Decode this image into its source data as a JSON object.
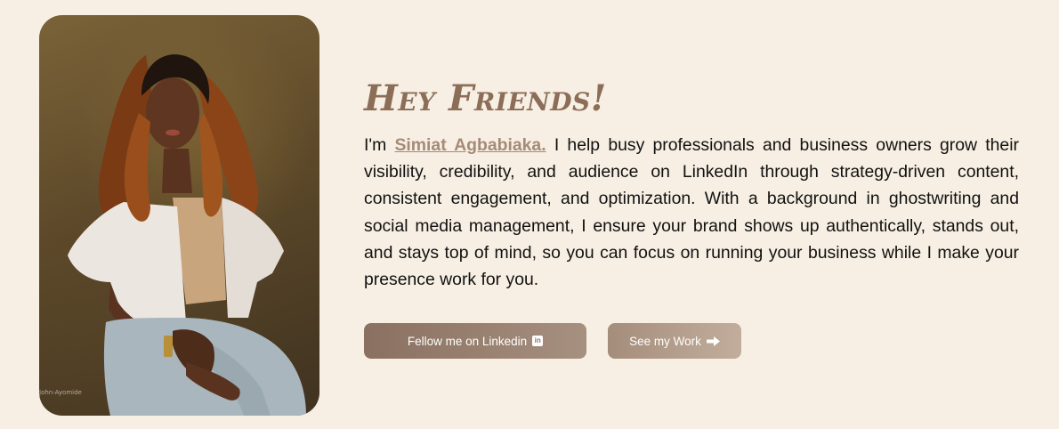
{
  "about": {
    "heading": "Hey Friends!",
    "intro_prefix": "I'm ",
    "name": "Simiat Agbabiaka.",
    "intro_body": " I help busy professionals and business owners grow their visibility, credibility, and audience on LinkedIn through strategy-driven content, consistent engagement, and optimization. With a background in ghostwriting and social media management, I ensure your brand shows up authentically, stands out, and stays top of mind, so you can focus on running your business while I make your presence work for you.",
    "photo_watermark": "John-Ayomide"
  },
  "buttons": {
    "linkedin_label": "Fellow me on Linkedin",
    "linkedin_icon": "linkedin-icon",
    "work_label": "See my Work",
    "work_icon": "arrow-right-icon"
  },
  "colors": {
    "page_background": "#f7efe3",
    "heading": "#8b6d58",
    "name_link": "#a58b77",
    "linkedin_button": "#8a7060",
    "work_button": "#a58d7b"
  }
}
